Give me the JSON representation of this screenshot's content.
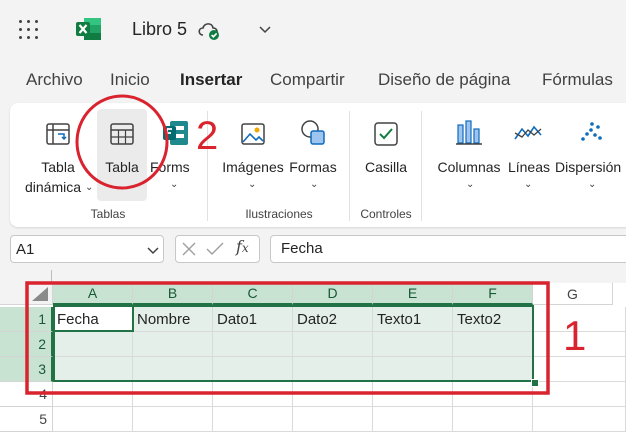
{
  "titlebar": {
    "doc_title": "Libro 5"
  },
  "menu": {
    "items": [
      "Archivo",
      "Inicio",
      "Insertar",
      "Compartir",
      "Diseño de página",
      "Fórmulas"
    ],
    "active": "Insertar"
  },
  "ribbon": {
    "tabla_dinamica_line1": "Tabla",
    "tabla_dinamica_line2": "dinámica",
    "tabla": "Tabla",
    "forms": "Forms",
    "imagenes": "Imágenes",
    "formas": "Formas",
    "casilla": "Casilla",
    "columnas": "Columnas",
    "lineas": "Líneas",
    "dispersion": "Dispersión",
    "groups": {
      "tablas": "Tablas",
      "ilustraciones": "Ilustraciones",
      "controles": "Controles"
    }
  },
  "formula_bar": {
    "name_box": "A1",
    "content": "Fecha"
  },
  "grid": {
    "columns": [
      "A",
      "B",
      "C",
      "D",
      "E",
      "F",
      "G"
    ],
    "rows": [
      "1",
      "2",
      "3",
      "4",
      "5"
    ],
    "row1": [
      "Fecha",
      "Nombre",
      "Dato1",
      "Dato2",
      "Texto1",
      "Texto2"
    ]
  },
  "annotations": {
    "label_1": "1",
    "label_2": "2",
    "color": "#d9232f"
  },
  "colors": {
    "excel_green": "#217346",
    "selection_fill": "#e3efe8",
    "header_selected": "#c9e3d2"
  }
}
